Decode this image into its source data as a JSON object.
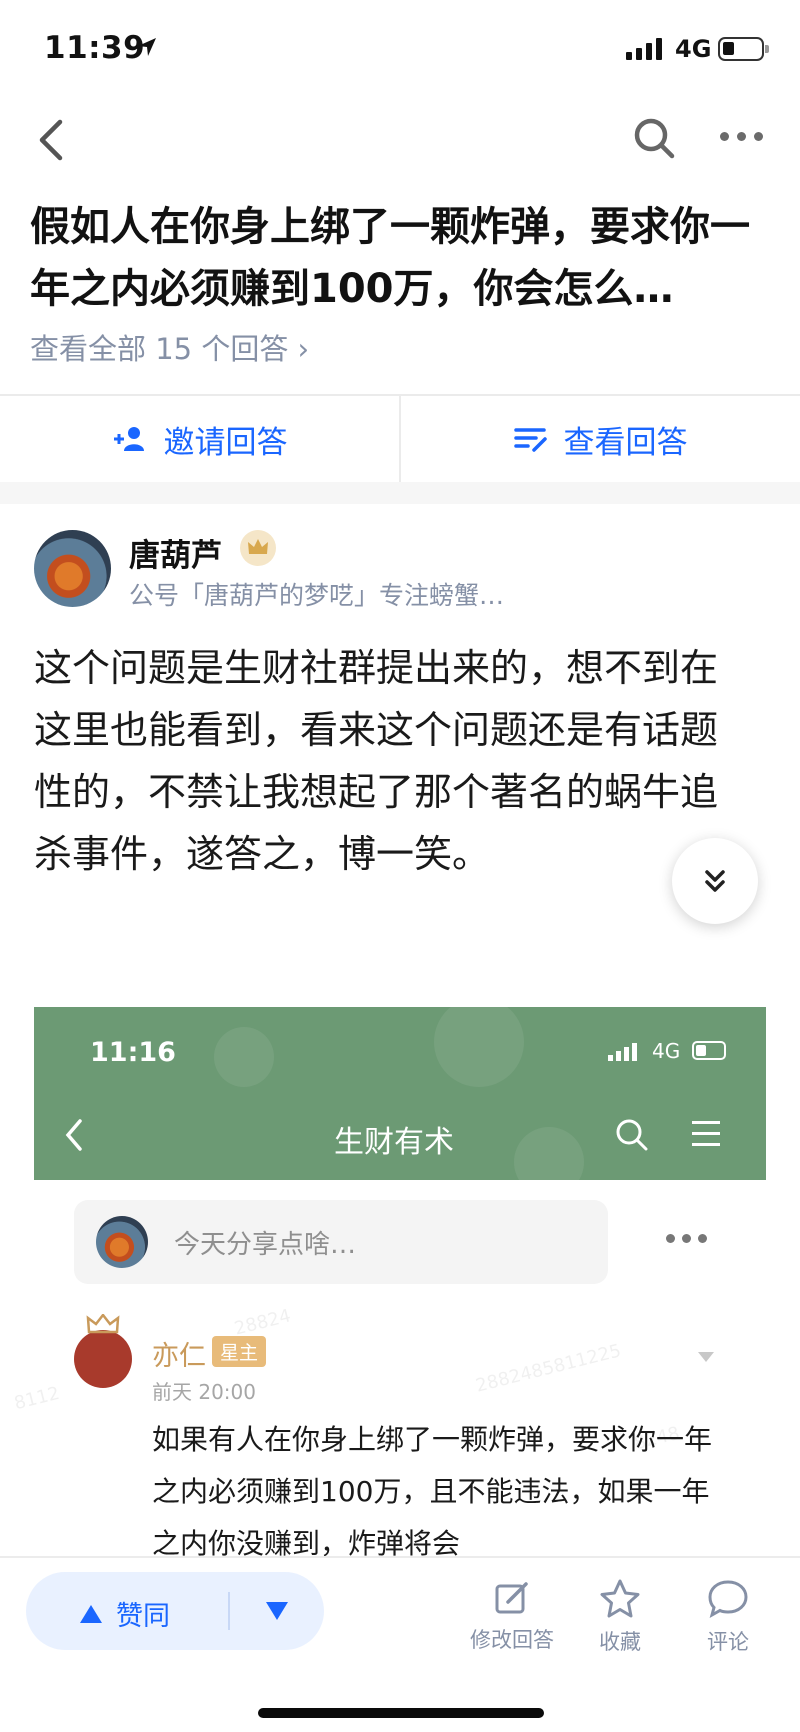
{
  "status_bar": {
    "time": "11:39",
    "network": "4G"
  },
  "question": {
    "title": "假如人在你身上绑了一颗炸弹，要求你一年之内必须赚到100万，你会怎么…",
    "view_all": "查看全部 15 个回答 ›"
  },
  "actions": {
    "invite": "邀请回答",
    "view": "查看回答"
  },
  "author": {
    "name": "唐葫芦",
    "bio": "公号「唐葫芦的梦呓」专注螃蟹…"
  },
  "answer_text": "这个问题是生财社群提出来的，想不到在这里也能看到，看来这个问题还是有话题性的，不禁让我想起了那个著名的蜗牛追杀事件，遂答之，博一笑。",
  "embedded": {
    "time": "11:16",
    "network": "4G",
    "title": "生财有术",
    "share_placeholder": "今天分享点啥…",
    "poster_name": "亦仁",
    "poster_tag": "星主",
    "post_time": "前天 20:00",
    "post_text": "如果有人在你身上绑了一颗炸弹，要求你一年之内必须赚到100万，且不能违法，如果一年之内你没赚到，炸弹将会"
  },
  "bottom_bar": {
    "upvote": "赞同",
    "edit": "修改回答",
    "favorite": "收藏",
    "comment": "评论"
  },
  "colors": {
    "accent": "#1a66ff",
    "embedded_green": "#6c9a74",
    "muted": "#8590a6"
  }
}
